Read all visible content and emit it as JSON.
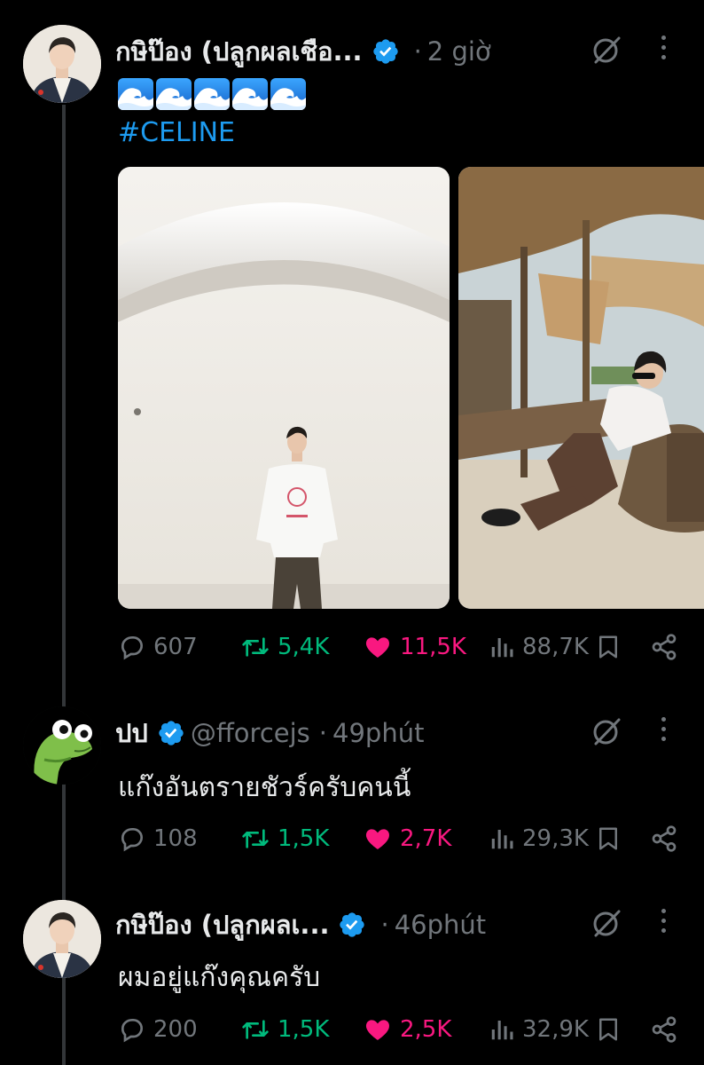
{
  "tweets": [
    {
      "author_name": "กษิป๊อง (ปลูกผลเชือ...",
      "handle": "",
      "time": "2 giờ",
      "emoji_row": [
        "wave",
        "wave",
        "wave",
        "wave",
        "wave"
      ],
      "text": "",
      "hashtag": "#CELINE",
      "stats": {
        "replies": "607",
        "retweets": "5,4K",
        "likes": "11,5K",
        "views": "88,7K"
      },
      "likes_active": true,
      "retweeted": true
    },
    {
      "author_name": "ปป",
      "handle": "@fforcejs",
      "time": "49phút",
      "text": "แก๊งอันตรายชัวร์ครับคนนี้",
      "stats": {
        "replies": "108",
        "retweets": "1,5K",
        "likes": "2,7K",
        "views": "29,3K"
      },
      "likes_active": true,
      "retweeted": true
    },
    {
      "author_name": "กษิป๊อง (ปลูกผลเ...",
      "handle": "",
      "time": "46phút",
      "text": "ผมอยู่แก๊งคุณครับ",
      "stats": {
        "replies": "200",
        "retweets": "1,5K",
        "likes": "2,5K",
        "views": "32,9K"
      },
      "likes_active": true,
      "retweeted": true
    }
  ],
  "icons": {
    "verified": "verified-badge-icon",
    "grok": "grok-icon",
    "more": "more-icon",
    "reply": "reply-icon",
    "retweet": "retweet-icon",
    "like": "heart-icon",
    "views": "views-icon",
    "bookmark": "bookmark-icon",
    "share": "share-icon"
  },
  "colors": {
    "background": "#000000",
    "text": "#e7e9ea",
    "muted": "#71767b",
    "link": "#1d9bf0",
    "retweet": "#00ba7c",
    "like": "#f91880",
    "verified": "#1d9bf0"
  }
}
